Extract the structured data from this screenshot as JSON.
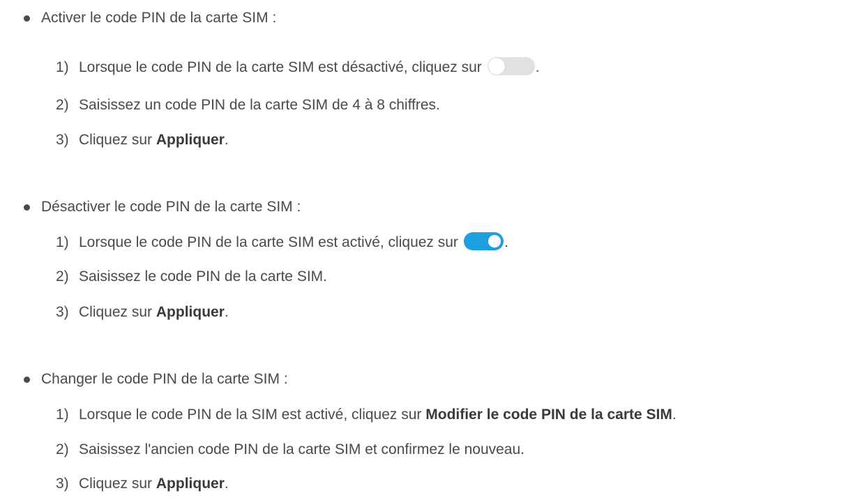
{
  "sections": [
    {
      "title": "Activer le code PIN de la carte SIM :",
      "steps": [
        {
          "num": "1)",
          "before": "Lorsque le code PIN de la carte SIM est désactivé, cliquez sur",
          "after": "."
        },
        {
          "num": "2)",
          "text": "Saisissez un code PIN de la carte SIM de 4 à 8 chiffres."
        },
        {
          "num": "3)",
          "before": "Cliquez sur ",
          "bold": "Appliquer",
          "after": "."
        }
      ]
    },
    {
      "title": "Désactiver le code PIN de la carte SIM :",
      "steps": [
        {
          "num": "1)",
          "before": "Lorsque le code PIN de la carte SIM est activé, cliquez sur",
          "after": "."
        },
        {
          "num": "2)",
          "text": "Saisissez le code PIN de la carte SIM."
        },
        {
          "num": "3)",
          "before": "Cliquez sur ",
          "bold": "Appliquer",
          "after": "."
        }
      ]
    },
    {
      "title": "Changer le code PIN de la carte SIM :",
      "steps": [
        {
          "num": "1)",
          "before": "Lorsque le code PIN de la SIM est activé, cliquez sur ",
          "bold": "Modifier le code PIN de la carte SIM",
          "after": "."
        },
        {
          "num": "2)",
          "text": "Saisissez l'ancien code PIN de la carte SIM et confirmez le nouveau."
        },
        {
          "num": "3)",
          "before": "Cliquez sur ",
          "bold": "Appliquer",
          "after": "."
        }
      ]
    }
  ],
  "toggles": {
    "off": {
      "state": "off",
      "track_color": "#e1e1e1"
    },
    "on": {
      "state": "on",
      "track_color": "#1e9fe0"
    }
  }
}
